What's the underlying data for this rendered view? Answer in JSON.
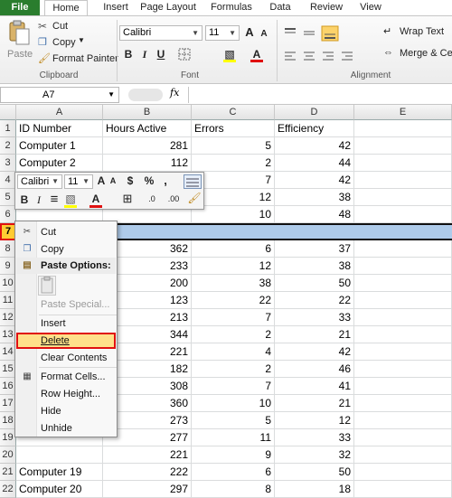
{
  "ribbon": {
    "tabs": [
      "File",
      "Home",
      "Insert",
      "Page Layout",
      "Formulas",
      "Data",
      "Review",
      "View"
    ],
    "clipboard": {
      "paste": "Paste",
      "cut": "Cut",
      "copy": "Copy",
      "format_painter": "Format Painter",
      "group": "Clipboard"
    },
    "font": {
      "name": "Calibri",
      "size": "11",
      "bold": "B",
      "italic": "I",
      "underline": "U",
      "grow": "A",
      "shrink": "A",
      "fill_glyph": "▧",
      "font_color_glyph": "A",
      "group": "Font"
    },
    "alignment": {
      "wrap_text": "Wrap Text",
      "merge_center": "Merge & Cent",
      "group": "Alignment"
    }
  },
  "formula_bar": {
    "name_box": "A7",
    "fx": "fx",
    "value": ""
  },
  "grid": {
    "columns": [
      "A",
      "B",
      "C",
      "D",
      "E"
    ],
    "rows": [
      {
        "n": "1",
        "a": "ID Number",
        "b": "Hours Active",
        "c": "Errors",
        "d": "Efficiency"
      },
      {
        "n": "2",
        "a": "Computer 1",
        "b": "281",
        "c": "5",
        "d": "42"
      },
      {
        "n": "3",
        "a": "Computer 2",
        "b": "112",
        "c": "2",
        "d": "44"
      },
      {
        "n": "4",
        "a": "",
        "b": "",
        "c": "7",
        "d": "42"
      },
      {
        "n": "5",
        "a": "",
        "b": "",
        "c": "12",
        "d": "38"
      },
      {
        "n": "6",
        "a": "",
        "b": "",
        "c": "10",
        "d": "48"
      },
      {
        "n": "7",
        "a": "",
        "b": "",
        "c": "",
        "d": ""
      },
      {
        "n": "8",
        "a": "",
        "b": "362",
        "c": "6",
        "d": "37"
      },
      {
        "n": "9",
        "a": "",
        "b": "233",
        "c": "12",
        "d": "38"
      },
      {
        "n": "10",
        "a": "",
        "b": "200",
        "c": "38",
        "d": "50"
      },
      {
        "n": "11",
        "a": "",
        "b": "123",
        "c": "22",
        "d": "22"
      },
      {
        "n": "12",
        "a": "",
        "b": "213",
        "c": "7",
        "d": "33"
      },
      {
        "n": "13",
        "a": "",
        "b": "344",
        "c": "2",
        "d": "21"
      },
      {
        "n": "14",
        "a": "",
        "b": "221",
        "c": "4",
        "d": "42"
      },
      {
        "n": "15",
        "a": "",
        "b": "182",
        "c": "2",
        "d": "46"
      },
      {
        "n": "16",
        "a": "",
        "b": "308",
        "c": "7",
        "d": "41"
      },
      {
        "n": "17",
        "a": "",
        "b": "360",
        "c": "10",
        "d": "21"
      },
      {
        "n": "18",
        "a": "",
        "b": "273",
        "c": "5",
        "d": "12"
      },
      {
        "n": "19",
        "a": "",
        "b": "277",
        "c": "11",
        "d": "33"
      },
      {
        "n": "20",
        "a": "",
        "b": "221",
        "c": "9",
        "d": "32"
      },
      {
        "n": "21",
        "a": "Computer 19",
        "b": "222",
        "c": "6",
        "d": "50"
      },
      {
        "n": "22",
        "a": "Computer 20",
        "b": "297",
        "c": "8",
        "d": "18"
      }
    ]
  },
  "mini_toolbar": {
    "font_name": "Calibri",
    "font_size": "11",
    "grow": "A",
    "shrink": "A",
    "currency": "$",
    "percent": "%",
    "comma": ",",
    "bold": "B",
    "italic": "I",
    "align": "≡",
    "fill_glyph": "▧",
    "font_color_glyph": "A",
    "borders_glyph": "⊞",
    "inc_decimal": ".0",
    "dec_decimal": ".00"
  },
  "context_menu": {
    "cut": "Cut",
    "copy": "Copy",
    "paste_options": "Paste Options:",
    "paste_special": "Paste Special...",
    "insert": "Insert",
    "delete": "Delete",
    "clear_contents": "Clear Contents",
    "format_cells": "Format Cells...",
    "row_height": "Row Height...",
    "hide": "Hide",
    "unhide": "Unhide"
  },
  "colors": {
    "file_tab": "#2a7d2e",
    "selection": "#aecbea",
    "highlight_border": "#e01010",
    "highlight_fill": "#ffe08a"
  }
}
